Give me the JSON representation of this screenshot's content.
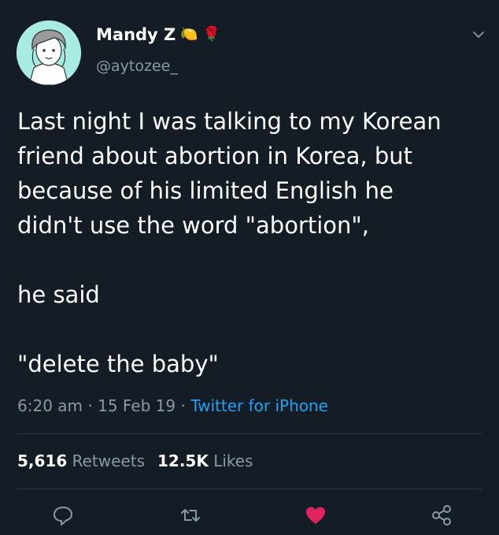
{
  "tweet": {
    "author": {
      "display_name": "Mandy Z",
      "emojis": [
        "🍋",
        "🌹"
      ],
      "handle": "@aytozee_"
    },
    "text": "Last night I was talking to my Korean\nfriend about abortion in Korea, but\nbecause of his limited English he\ndidn't use the word \"abortion\",\n\nhe said\n\n\"delete the baby\"",
    "time": "6:20 am",
    "sep1": "·",
    "date": "15 Feb 19",
    "sep2": "·",
    "source": "Twitter for iPhone",
    "stats": {
      "retweets_count": "5,616",
      "retweets_label": "Retweets",
      "likes_count": "12.5K",
      "likes_label": "Likes"
    }
  },
  "icons": {
    "reply": "reply-icon",
    "retweet": "retweet-icon",
    "like": "heart-icon",
    "share": "share-icon",
    "menu": "chevron-down-icon"
  },
  "colors": {
    "background": "#141d26",
    "secondary_text": "#8899a6",
    "link": "#1da1f2",
    "like": "#e0245e"
  }
}
